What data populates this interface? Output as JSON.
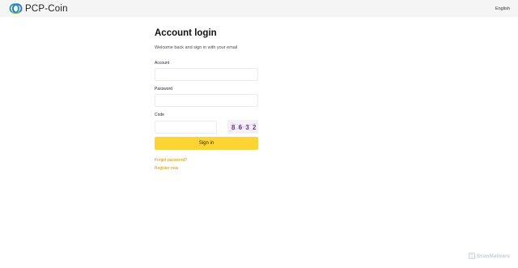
{
  "header": {
    "brand_name": "PCP-Coin",
    "language": "English"
  },
  "login": {
    "title": "Account login",
    "subtitle": "Welcome back and sign in with your email",
    "account_label": "Account",
    "account_value": "",
    "password_label": "Password",
    "password_value": "",
    "code_label": "Code",
    "code_value": "",
    "captcha_text": "8 6 3 2",
    "signin_label": "Sign in",
    "forgot_label": "Forget password?",
    "register_label": "Register now"
  },
  "watermark": {
    "text": "ScanMalware",
    "icon": "scanmalware-logo-icon"
  },
  "colors": {
    "accent": "#fcd535",
    "link": "#c99400",
    "topbar": "#f5f5f5",
    "captcha_digits": "#6b2fa0"
  }
}
